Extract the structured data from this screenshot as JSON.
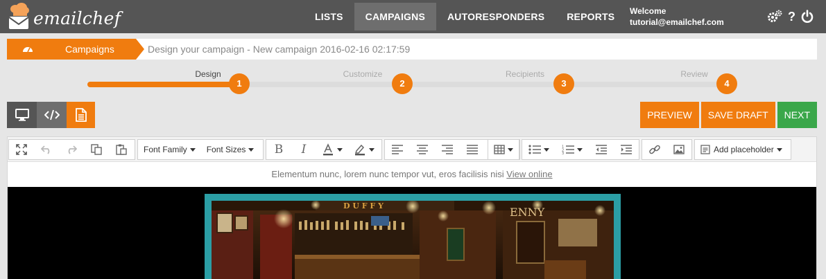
{
  "app": {
    "logo_text": "emailchef"
  },
  "nav": {
    "items": [
      {
        "label": "LISTS",
        "active": false
      },
      {
        "label": "CAMPAIGNS",
        "active": true
      },
      {
        "label": "AUTORESPONDERS",
        "active": false
      },
      {
        "label": "REPORTS",
        "active": false
      }
    ],
    "welcome_label": "Welcome",
    "user_email": "tutorial@emailchef.com",
    "icons": [
      "gears-icon",
      "help-icon",
      "power-icon"
    ]
  },
  "breadcrumb": {
    "home_icon": "dashboard-icon",
    "section": "Campaigns",
    "page_title": "Design your campaign - New campaign 2016-02-16 02:17:59"
  },
  "steps": [
    {
      "number": "1",
      "label": "Design",
      "active": true
    },
    {
      "number": "2",
      "label": "Customize",
      "active": false
    },
    {
      "number": "3",
      "label": "Recipients",
      "active": false
    },
    {
      "number": "4",
      "label": "Review",
      "active": false
    }
  ],
  "view_modes": [
    {
      "icon": "desktop-icon",
      "active": false
    },
    {
      "icon": "code-icon",
      "active": true
    },
    {
      "icon": "document-icon",
      "active": false
    }
  ],
  "actions": {
    "preview": "PREVIEW",
    "save_draft": "SAVE DRAFT",
    "next": "NEXT"
  },
  "editor_toolbar": {
    "font_family": "Font Family",
    "font_sizes": "Font Sizes",
    "add_placeholder": "Add placeholder"
  },
  "email": {
    "preheader_text": "Elementum nunc, lorem nunc tempor vut, eros facilisis nisi",
    "view_online": "View online"
  },
  "colors": {
    "accent_orange": "#f07c0f",
    "next_green": "#3aa74a",
    "topbar": "#555555",
    "hero_frame": "#2b9ea5"
  }
}
